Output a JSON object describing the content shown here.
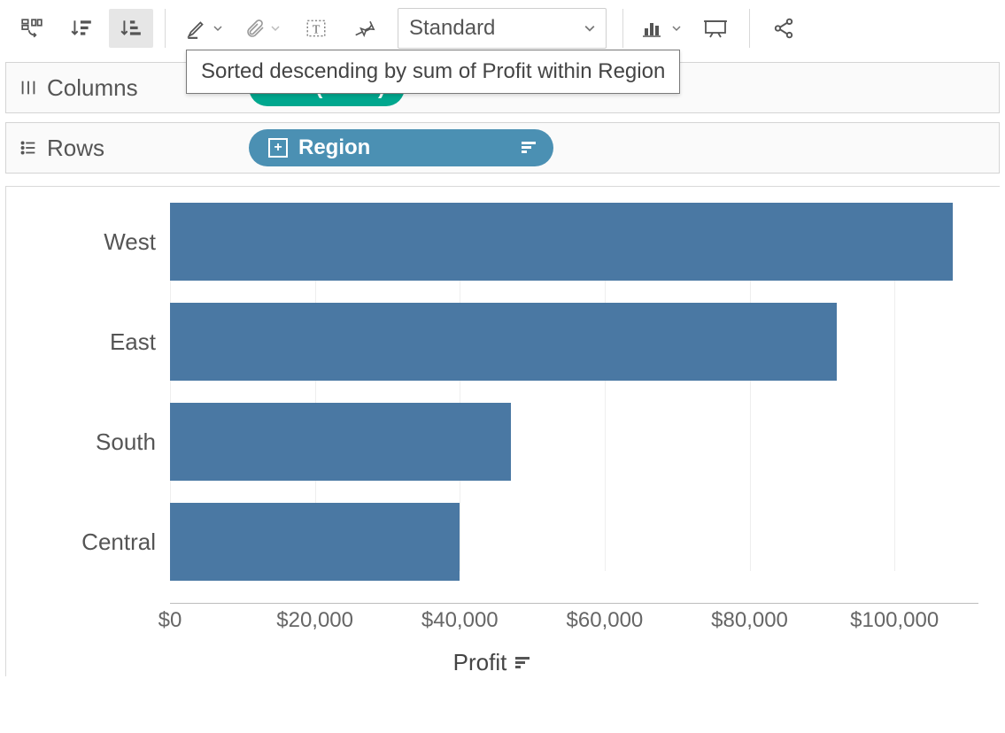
{
  "toolbar": {
    "fit_mode": "Standard",
    "tooltip": "Sorted descending by sum of Profit within Region"
  },
  "shelves": {
    "columns": {
      "label": "Columns",
      "pill": "SUM(Profit)"
    },
    "rows": {
      "label": "Rows",
      "pill": "Region"
    }
  },
  "axis": {
    "title": "Profit",
    "ticks": [
      {
        "label": "$0",
        "value": 0
      },
      {
        "label": "$20,000",
        "value": 20000
      },
      {
        "label": "$40,000",
        "value": 40000
      },
      {
        "label": "$60,000",
        "value": 60000
      },
      {
        "label": "$80,000",
        "value": 80000
      },
      {
        "label": "$100,000",
        "value": 100000
      }
    ],
    "max": 110000
  },
  "chart_data": {
    "type": "bar",
    "orientation": "horizontal",
    "categories": [
      "West",
      "East",
      "South",
      "Central"
    ],
    "values": [
      108000,
      92000,
      47000,
      40000
    ],
    "xlabel": "Profit",
    "ylabel": "Region",
    "xlim": [
      0,
      110000
    ],
    "sort": "descending"
  },
  "colors": {
    "bar": "#4a78a3",
    "pill_measure": "#00a78e",
    "pill_dimension": "#4b90b3"
  }
}
